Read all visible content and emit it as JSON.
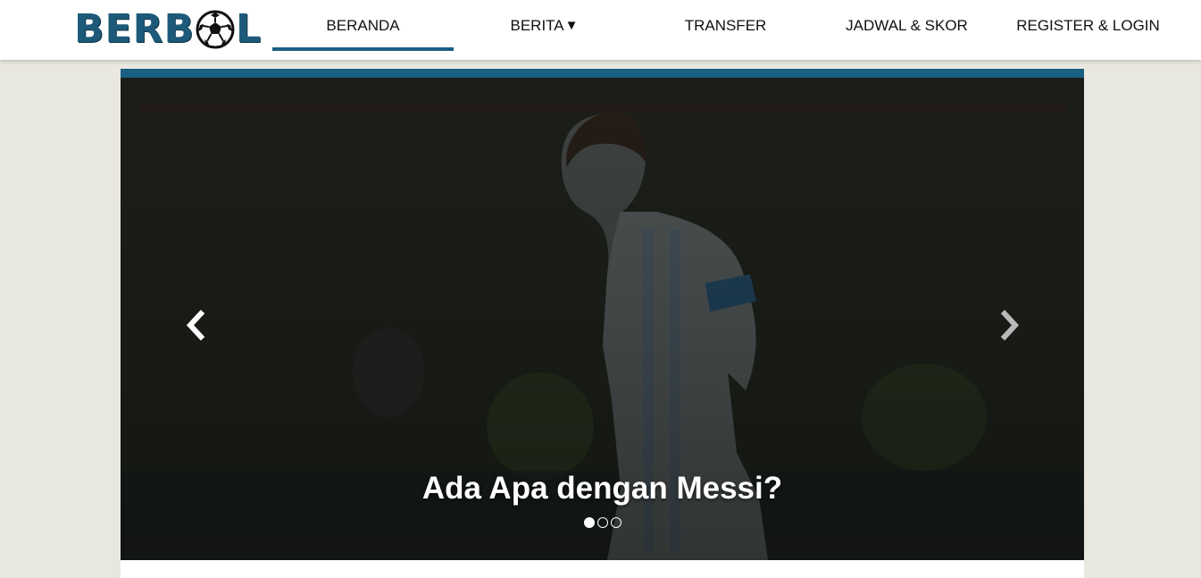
{
  "site": {
    "logo": {
      "prefix": "BERB",
      "suffix": "L",
      "icon": "soccer-ball-icon"
    }
  },
  "nav": {
    "items": [
      {
        "label": "BERANDA",
        "active": true
      },
      {
        "label": "BERITA",
        "dropdown_glyph": "▼"
      },
      {
        "label": "TRANSFER"
      },
      {
        "label": "JADWAL & SKOR"
      },
      {
        "label": "REGISTER & LOGIN"
      }
    ]
  },
  "slider": {
    "title": "Ada Apa dengan Messi?",
    "prev_icon": "chevron-left-icon",
    "next_icon": "chevron-right-icon",
    "slide_count": 3,
    "active_index": 0
  },
  "colors": {
    "accent": "#1b5f83",
    "page_background": "#e9e8e0",
    "header_background": "#ffffff"
  }
}
